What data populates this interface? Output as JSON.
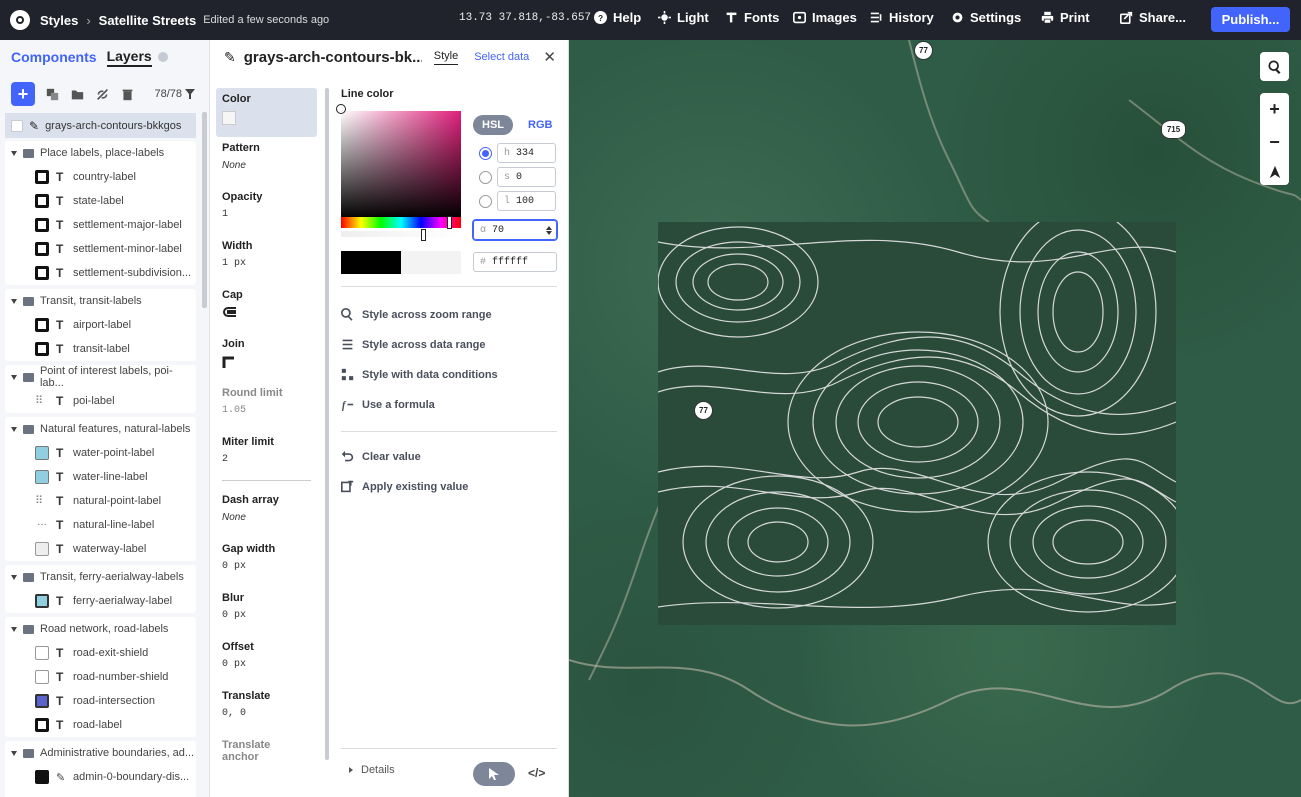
{
  "topbar": {
    "breadcrumb_root": "Styles",
    "style_name": "Satellite Streets",
    "edited_status": "Edited a few seconds ago",
    "coords": "13.73 37.818,-83.657",
    "help": "Help",
    "light": "Light",
    "fonts": "Fonts",
    "images": "Images",
    "history": "History",
    "settings": "Settings",
    "print": "Print",
    "share": "Share...",
    "publish": "Publish..."
  },
  "sidebar": {
    "tab_components": "Components",
    "tab_layers": "Layers",
    "layer_count": "78/78",
    "selected_layer": "grays-arch-contours-bkkgos",
    "groups": [
      {
        "name": "Place labels, place-labels",
        "items": [
          "country-label",
          "state-label",
          "settlement-major-label",
          "settlement-minor-label",
          "settlement-subdivision..."
        ]
      },
      {
        "name": "Transit, transit-labels",
        "items": [
          "airport-label",
          "transit-label"
        ]
      },
      {
        "name": "Point of interest labels, poi-lab...",
        "items": [
          "poi-label"
        ]
      },
      {
        "name": "Natural features, natural-labels",
        "items": [
          "water-point-label",
          "water-line-label",
          "natural-point-label",
          "natural-line-label",
          "waterway-label"
        ]
      },
      {
        "name": "Transit, ferry-aerialway-labels",
        "items": [
          "ferry-aerialway-label"
        ]
      },
      {
        "name": "Road network, road-labels",
        "items": [
          "road-exit-shield",
          "road-number-shield",
          "road-intersection",
          "road-label"
        ]
      },
      {
        "name": "Administrative boundaries, ad...",
        "items": [
          "admin-0-boundary-dis..."
        ]
      }
    ]
  },
  "editor": {
    "layer_title": "grays-arch-contours-bk...",
    "tab_style": "Style",
    "tab_select_data": "Select data",
    "properties": [
      {
        "name": "Color",
        "value": ""
      },
      {
        "name": "Pattern",
        "value": "None"
      },
      {
        "name": "Opacity",
        "value": "1"
      },
      {
        "name": "Width",
        "value": "1 px"
      },
      {
        "name": "Cap",
        "value": ""
      },
      {
        "name": "Join",
        "value": ""
      },
      {
        "name": "Round limit",
        "value": "1.05"
      },
      {
        "name": "Miter limit",
        "value": "2"
      },
      {
        "name": "Dash array",
        "value": "None"
      },
      {
        "name": "Gap width",
        "value": "0 px"
      },
      {
        "name": "Blur",
        "value": "0 px"
      },
      {
        "name": "Offset",
        "value": "0 px"
      },
      {
        "name": "Translate",
        "value": "0, 0"
      },
      {
        "name": "Translate anchor",
        "value": ""
      }
    ],
    "color_panel": {
      "label": "Line color",
      "mode_hsl": "HSL",
      "mode_rgb": "RGB",
      "h_prefix": "h",
      "h_value": "334",
      "s_prefix": "s",
      "s_value": "0",
      "l_prefix": "l",
      "l_value": "100",
      "alpha_prefix": "α",
      "alpha_value": "70",
      "hex_prefix": "#",
      "hex_value": "ffffff"
    },
    "actions": [
      "Style across zoom range",
      "Style across data range",
      "Style with data conditions",
      "Use a formula"
    ],
    "clear_value": "Clear value",
    "apply_existing": "Apply existing value",
    "details": "Details",
    "code_label": "</>"
  },
  "map": {
    "shields": [
      "77",
      "715",
      "77"
    ]
  }
}
